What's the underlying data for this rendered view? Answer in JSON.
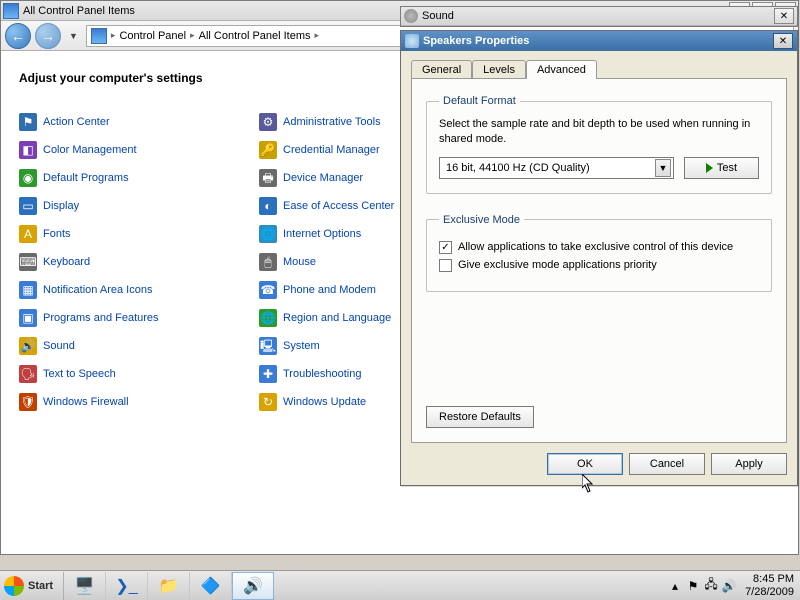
{
  "cp": {
    "title": "All Control Panel Items",
    "breadcrumb": {
      "root": "Control Panel",
      "leaf": "All Control Panel Items"
    },
    "heading": "Adjust your computer's settings",
    "left": [
      {
        "label": "Action Center",
        "icon": "⚑",
        "bg": "#2f6fb0"
      },
      {
        "label": "Color Management",
        "icon": "◧",
        "bg": "#7a3fb5"
      },
      {
        "label": "Default Programs",
        "icon": "◉",
        "bg": "#2c9a2c"
      },
      {
        "label": "Display",
        "icon": "▭",
        "bg": "#2b6fbf"
      },
      {
        "label": "Fonts",
        "icon": "A",
        "bg": "#d8a200"
      },
      {
        "label": "Keyboard",
        "icon": "⌨",
        "bg": "#6a6a6a"
      },
      {
        "label": "Notification Area Icons",
        "icon": "▦",
        "bg": "#3a7bd5"
      },
      {
        "label": "Programs and Features",
        "icon": "▣",
        "bg": "#3a7bd5"
      },
      {
        "label": "Sound",
        "icon": "🔊",
        "bg": "#d8a200"
      },
      {
        "label": "Text to Speech",
        "icon": "🗣",
        "bg": "#c04040"
      },
      {
        "label": "Windows Firewall",
        "icon": "🛡",
        "bg": "#c04000"
      }
    ],
    "right": [
      {
        "label": "Administrative Tools",
        "icon": "⚙",
        "bg": "#5a5a9a"
      },
      {
        "label": "Credential Manager",
        "icon": "🔑",
        "bg": "#c8a000"
      },
      {
        "label": "Device Manager",
        "icon": "🖶",
        "bg": "#6a6a6a"
      },
      {
        "label": "Ease of Access Center",
        "icon": "◐",
        "bg": "#2b6fbf"
      },
      {
        "label": "Internet Options",
        "icon": "🌐",
        "bg": "#2b8fbf"
      },
      {
        "label": "Mouse",
        "icon": "🖱",
        "bg": "#6a6a6a"
      },
      {
        "label": "Phone and Modem",
        "icon": "☎",
        "bg": "#3a7bd5"
      },
      {
        "label": "Region and Language",
        "icon": "🌐",
        "bg": "#2c9a2c"
      },
      {
        "label": "System",
        "icon": "🖳",
        "bg": "#3a7bd5"
      },
      {
        "label": "Troubleshooting",
        "icon": "✚",
        "bg": "#3a7bd5"
      },
      {
        "label": "Windows Update",
        "icon": "↻",
        "bg": "#d8a200"
      }
    ]
  },
  "sound": {
    "title": "Sound"
  },
  "props": {
    "title": "Speakers Properties",
    "tabs": {
      "general": "General",
      "levels": "Levels",
      "advanced": "Advanced"
    },
    "default_format": {
      "legend": "Default Format",
      "desc": "Select the sample rate and bit depth to be used when running in shared mode.",
      "selected": "16 bit, 44100 Hz (CD Quality)",
      "test": "Test"
    },
    "exclusive_mode": {
      "legend": "Exclusive Mode",
      "opt1": "Allow applications to take exclusive control of this device",
      "opt1_checked": true,
      "opt2": "Give exclusive mode applications priority",
      "opt2_checked": false
    },
    "restore": "Restore Defaults",
    "buttons": {
      "ok": "OK",
      "cancel": "Cancel",
      "apply": "Apply"
    }
  },
  "taskbar": {
    "start": "Start",
    "clock_time": "8:45 PM",
    "clock_date": "7/28/2009"
  }
}
